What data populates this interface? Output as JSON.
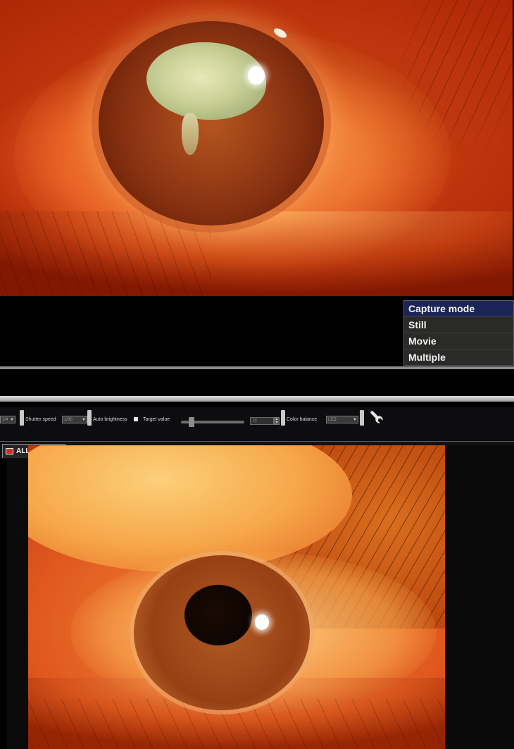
{
  "capture_menu": {
    "header": "Capture mode",
    "items": [
      "Still",
      "Movie",
      "Multiple"
    ]
  },
  "toolbar": {
    "first_select_value": "1/4",
    "shutter_speed_label": "Shutter speed",
    "shutter_speed_value": "1/30",
    "auto_brightness_label": "Auto brightness",
    "target_value_label": "Target value",
    "target_value_number": "70",
    "color_balance_label": "Color balance",
    "color_balance_value": "LED"
  },
  "tabs": {
    "all_images_label": "ALL IMAGES"
  },
  "icons": {
    "tool": "wrench-icon",
    "images": "images-icon"
  },
  "colors": {
    "menu_header_bg": "#1d2558",
    "menu_item_bg": "#2a2a28",
    "tab_icon_red": "#c83028"
  }
}
